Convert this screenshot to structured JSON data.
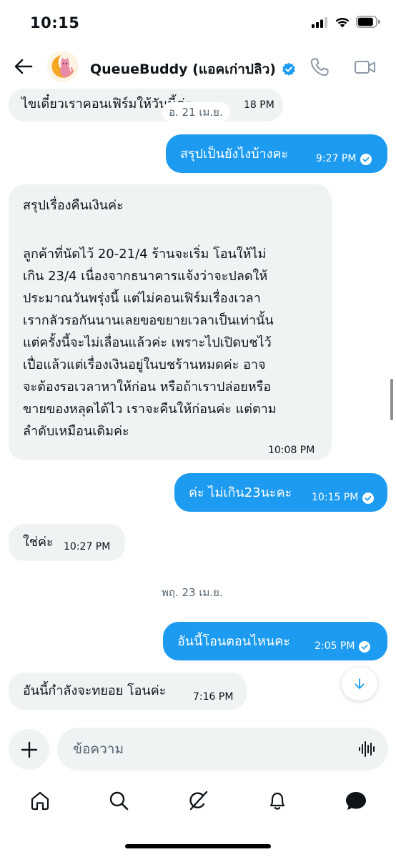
{
  "status_bar": {
    "time": "10:15"
  },
  "header": {
    "title": "QueueBuddy (แอคเก่าปลิว)",
    "verified": true,
    "icons": [
      "back-arrow-icon",
      "phone-icon",
      "video-camera-icon"
    ]
  },
  "messages": [
    {
      "direction": "in",
      "text": "ไขเดี๋ยวเราคอนเฟิร์มให้วันนี้ค่ะ",
      "time": "18 PM"
    },
    {
      "direction": "out",
      "text": "สรุปเป็นยังไงบ้างคะ",
      "time": "9:27 PM"
    },
    {
      "direction": "in",
      "lines": [
        "สรุปเรื่องคืนเงินค่ะ",
        "",
        "ลูกค้าที่นัดไว้ 20-21/4 ร้านจะเริ่ม โอนให้ไม่",
        "เกิน 23/4 เนื่องจากธนาคารแจ้งว่าจะปลดให้",
        "ประมาณวันพรุ่งนี้ แต่ไม่คอนเฟิร์มเรื่องเวลา",
        "เรากลัวรอกันนานเลยขอขยายเวลาเป็นเท่านั้น",
        "แต่ครั้งนี้จะไม่เลื่อนแล้วค่ะ เพราะไปเปิดบชไว้",
        "เปื่อแล้วแต่เรื่องเงินอยู่ในบชร้านหมดค่ะ อาจ",
        "จะต้องรอเวลาหาให้ก่อน หรือถ้าเราปล่อยหรือ",
        "ขายของหลุดได้ไว เราจะคืนให้ก่อนค่ะ แต่ตาม",
        "ลำดับเหมือนเดิมค่ะ"
      ],
      "time": "10:08 PM"
    },
    {
      "direction": "out",
      "text": "ค่ะ ไม่เกิน23นะคะ",
      "time": "10:15 PM"
    },
    {
      "direction": "in",
      "text": "ใช่ค่ะ",
      "time": "10:27 PM"
    },
    {
      "direction": "out",
      "text": "อันนี้โอนตอนไหนคะ",
      "time": "2:05 PM"
    },
    {
      "direction": "in",
      "text": "อันนี้กำลังจะทยอย โอนค่ะ",
      "time": "7:16 PM"
    }
  ],
  "date_dividers": [
    "อ. 21 เม.ย.",
    "พฤ. 23 เม.ย."
  ],
  "composer": {
    "placeholder": "ข้อความ"
  },
  "tab_bar": {
    "items": [
      "home-icon",
      "search-icon",
      "grok-icon",
      "notifications-icon",
      "messages-icon"
    ],
    "active": "messages-icon"
  },
  "colors": {
    "accent": "#1d9bf0",
    "incoming_bubble": "#eff3f4",
    "text_primary": "#0f1419",
    "text_secondary": "#536471"
  }
}
